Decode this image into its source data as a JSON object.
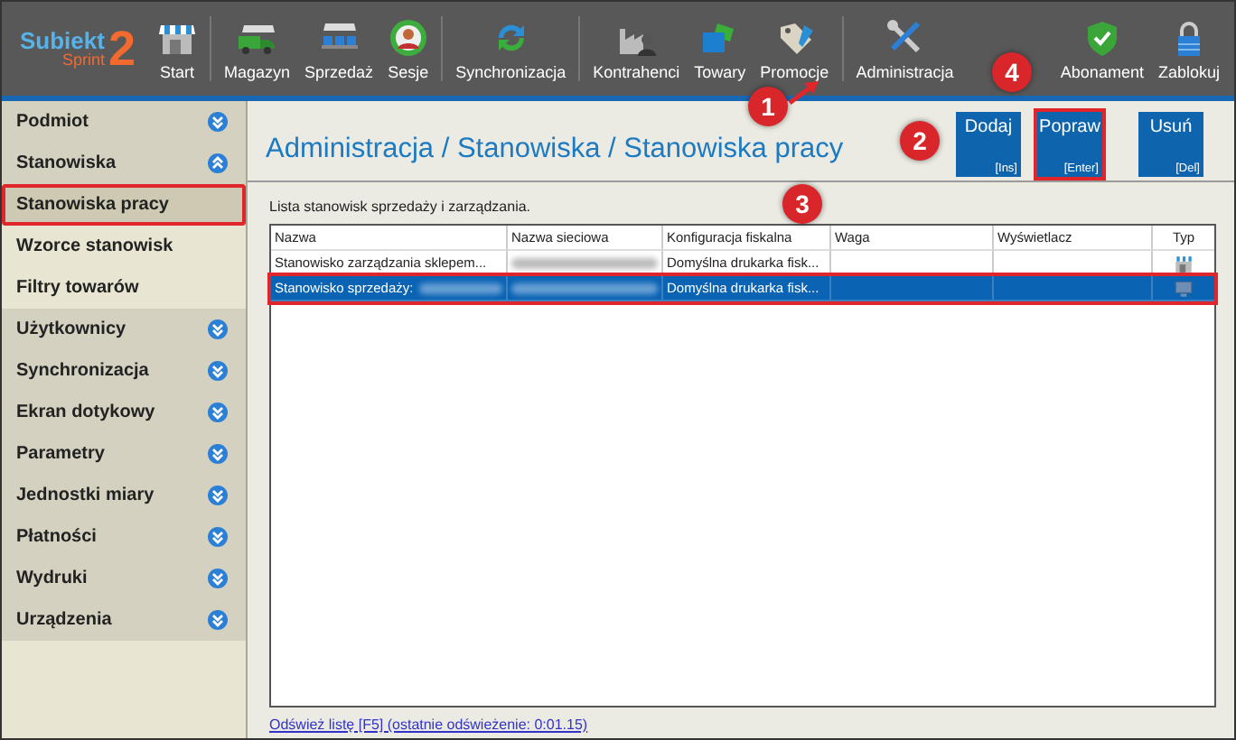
{
  "logo": {
    "name": "Subiekt",
    "edition": "Sprint",
    "number": "2"
  },
  "toolbar": {
    "items": [
      {
        "label": "Start",
        "kind": "shop",
        "separator_after": true
      },
      {
        "label": "Magazyn",
        "kind": "truck",
        "separator_after": false
      },
      {
        "label": "Sprzedaż",
        "kind": "carts",
        "separator_after": false
      },
      {
        "label": "Sesje",
        "kind": "person",
        "separator_after": true
      },
      {
        "label": "Synchronizacja",
        "kind": "sync",
        "separator_after": true
      },
      {
        "label": "Kontrahenci",
        "kind": "factory",
        "separator_after": false
      },
      {
        "label": "Towary",
        "kind": "boxes",
        "separator_after": false
      },
      {
        "label": "Promocje",
        "kind": "tag",
        "separator_after": true
      },
      {
        "label": "Administracja",
        "kind": "tools",
        "separator_after": false
      }
    ],
    "right_items": [
      {
        "label": "Abonament",
        "kind": "shield",
        "separator_after": false
      },
      {
        "label": "Zablokuj",
        "kind": "lock",
        "separator_after": false
      }
    ]
  },
  "sidebar": {
    "items": [
      {
        "label": "Podmiot",
        "kind": "group",
        "expanded": false,
        "selected": false,
        "highlighted": false
      },
      {
        "label": "Stanowiska",
        "kind": "group",
        "expanded": true,
        "selected": false,
        "highlighted": false
      },
      {
        "label": "Stanowiska pracy",
        "kind": "sub",
        "selected": true,
        "highlighted": true
      },
      {
        "label": "Wzorce stanowisk",
        "kind": "sub",
        "selected": false,
        "highlighted": false
      },
      {
        "label": "Filtry towarów",
        "kind": "sub",
        "selected": false,
        "highlighted": false
      },
      {
        "label": "Użytkownicy",
        "kind": "group",
        "expanded": false,
        "selected": false,
        "highlighted": false
      },
      {
        "label": "Synchronizacja",
        "kind": "group",
        "expanded": false,
        "selected": false,
        "highlighted": false
      },
      {
        "label": "Ekran dotykowy",
        "kind": "group",
        "expanded": false,
        "selected": false,
        "highlighted": false
      },
      {
        "label": "Parametry",
        "kind": "group",
        "expanded": false,
        "selected": false,
        "highlighted": false
      },
      {
        "label": "Jednostki miary",
        "kind": "group",
        "expanded": false,
        "selected": false,
        "highlighted": false
      },
      {
        "label": "Płatności",
        "kind": "group",
        "expanded": false,
        "selected": false,
        "highlighted": false
      },
      {
        "label": "Wydruki",
        "kind": "group",
        "expanded": false,
        "selected": false,
        "highlighted": false
      },
      {
        "label": "Urządzenia",
        "kind": "group",
        "expanded": false,
        "selected": false,
        "highlighted": false
      }
    ]
  },
  "content": {
    "title": "Administracja / Stanowiska / Stanowiska pracy",
    "buttons": [
      {
        "label": "Dodaj",
        "shortcut": "[Ins]",
        "highlighted": false
      },
      {
        "label": "Popraw",
        "shortcut": "[Enter]",
        "highlighted": true
      },
      {
        "label": "Usuń",
        "shortcut": "[Del]",
        "highlighted": false
      }
    ],
    "description": "Lista stanowisk sprzedaży i zarządzania.",
    "table": {
      "columns": [
        "Nazwa",
        "Nazwa sieciowa",
        "Konfiguracja fiskalna",
        "Waga",
        "Wyświetlacz",
        "Typ"
      ],
      "rows": [
        {
          "name": "Stanowisko zarządzania sklepem...",
          "name_blurred": false,
          "network_name_blurred": true,
          "fiscal_config": "Domyślna drukarka fisk...",
          "kind": "shop",
          "selected": false,
          "highlighted": false
        },
        {
          "name": "Stanowisko sprzedaży:",
          "name_blurred": true,
          "network_name_blurred": true,
          "fiscal_config": "Domyślna drukarka fisk...",
          "kind": "monitor",
          "selected": true,
          "highlighted": true
        }
      ]
    },
    "refresh_link": "Odśwież listę [F5] (ostatnie odświeżenie: 0:01.15)"
  },
  "annotations": [
    {
      "label": "1",
      "arrow": true
    },
    {
      "label": "2",
      "arrow": false
    },
    {
      "label": "3",
      "arrow": false
    },
    {
      "label": "4",
      "arrow": false
    }
  ]
}
